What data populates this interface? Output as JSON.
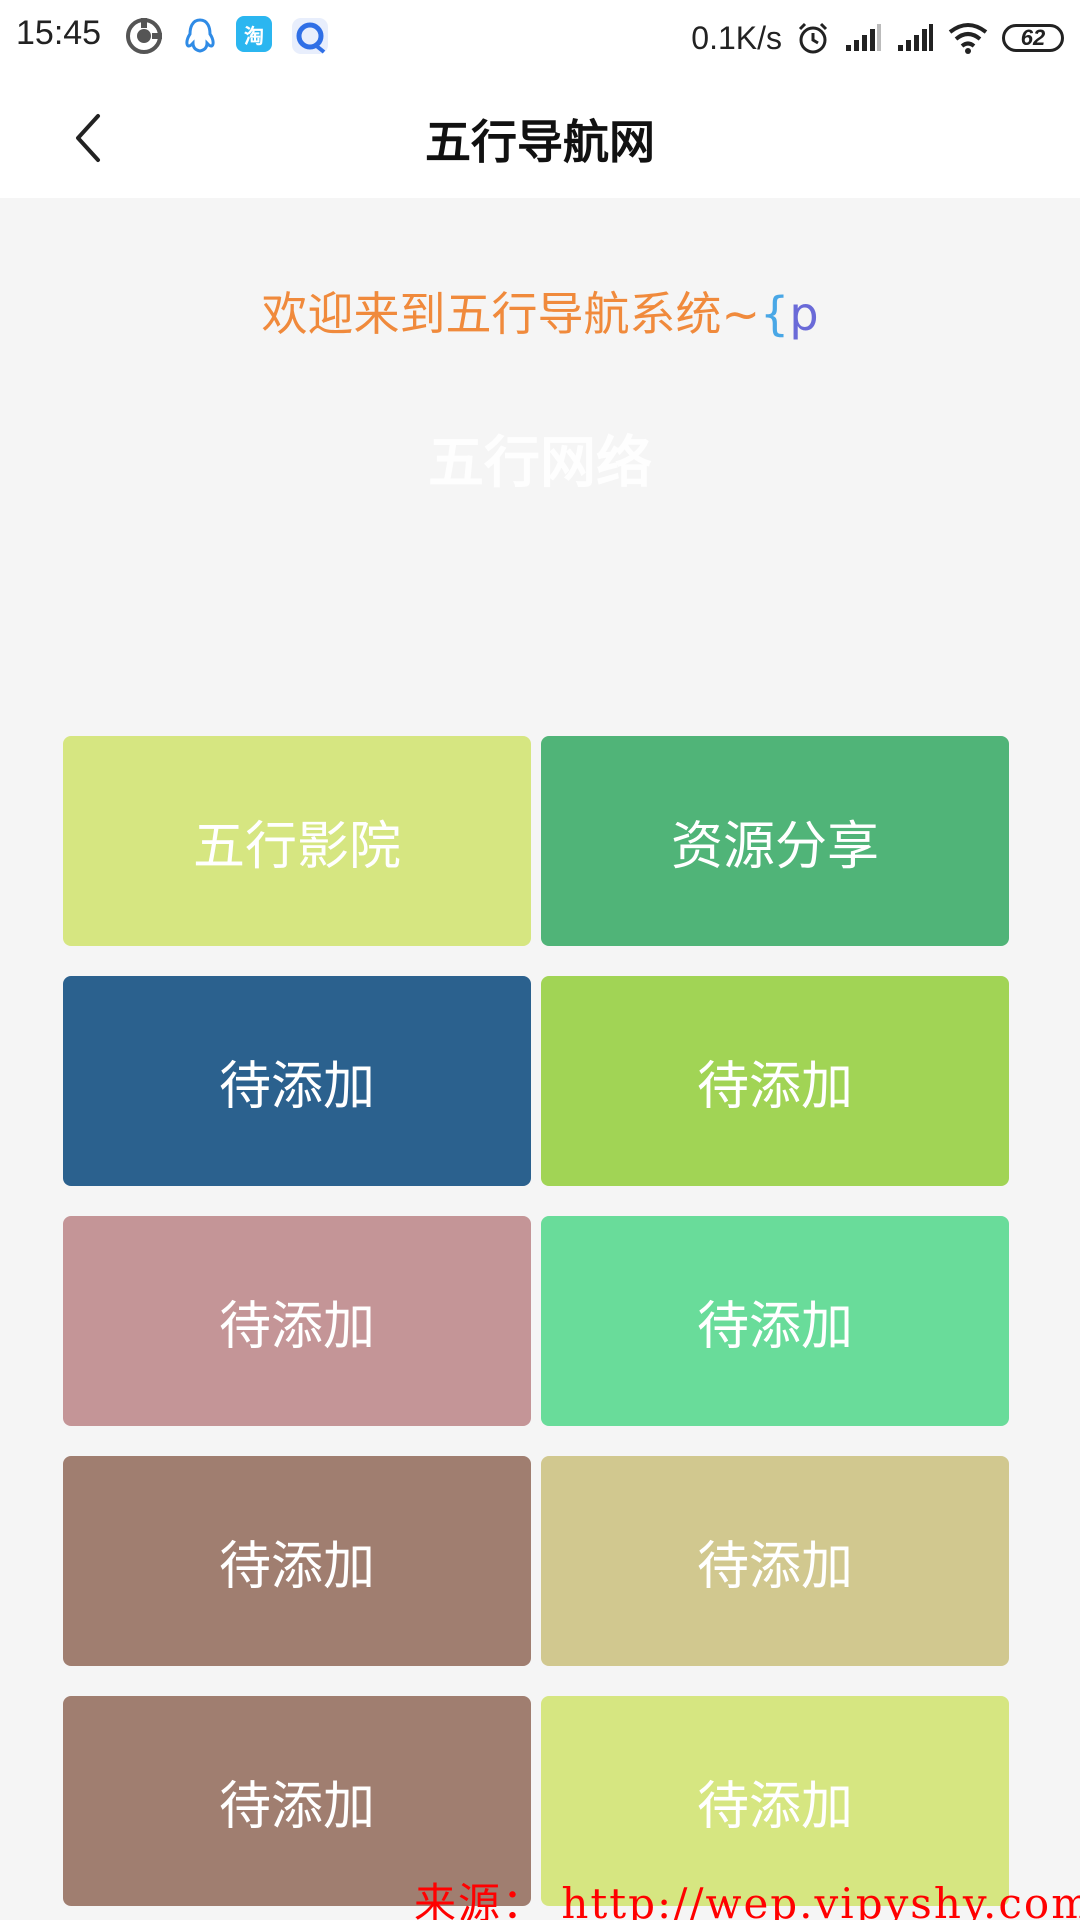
{
  "status_bar": {
    "time": "15:45",
    "net_speed": "0.1K/s",
    "battery": "62",
    "taobao_label": "淘",
    "icons": [
      "hub-icon",
      "qq-icon",
      "taobao-icon",
      "browser-icon",
      "alarm-icon",
      "signal-icon",
      "signal-icon",
      "wifi-icon",
      "battery-icon"
    ]
  },
  "nav": {
    "back_icon": "chevron-left-icon",
    "title": "五行导航网"
  },
  "content": {
    "welcome_text": "欢迎来到五行导航系统~",
    "welcome_brace": "{",
    "welcome_p": "p",
    "faded_title": "五行网络"
  },
  "tiles": [
    {
      "label": "五行影院",
      "color": "#d6e681"
    },
    {
      "label": "资源分享",
      "color": "#50b478"
    },
    {
      "label": "待添加",
      "color": "#2b618e"
    },
    {
      "label": "待添加",
      "color": "#a1d455"
    },
    {
      "label": "待添加",
      "color": "#c49597"
    },
    {
      "label": "待添加",
      "color": "#69dc9a"
    },
    {
      "label": "待添加",
      "color": "#a07e70"
    },
    {
      "label": "待添加",
      "color": "#d1c88f"
    },
    {
      "label": "待添加",
      "color": "#a07e70"
    },
    {
      "label": "待添加",
      "color": "#d6e681"
    }
  ],
  "watermark": "来源： http://wep.vipyshy.com"
}
